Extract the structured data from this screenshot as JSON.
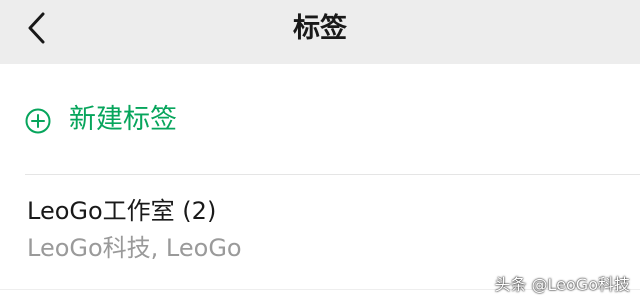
{
  "header": {
    "title": "标签",
    "back_icon": "chevron-left-icon"
  },
  "new_tag": {
    "icon": "plus-circle-icon",
    "label": "新建标签",
    "color": "#07a55c"
  },
  "tags": [
    {
      "name": "LeoGo工作室 (2)",
      "members": "LeoGo科技, LeoGo"
    }
  ],
  "watermark": "头条 @LeoGo科技",
  "colors": {
    "header_bg": "#ededed",
    "accent": "#07a55c",
    "primary_text": "#191919",
    "secondary_text": "#9a9a9a"
  }
}
